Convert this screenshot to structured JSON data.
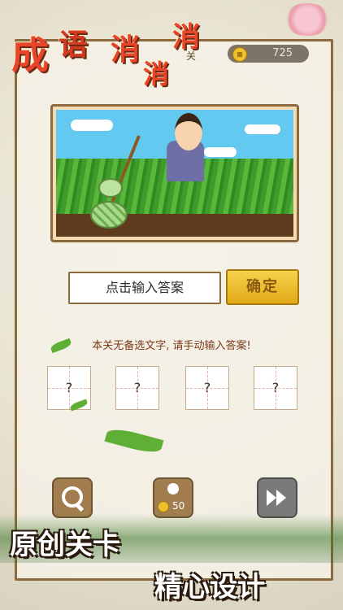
{
  "title": {
    "chars": [
      "成",
      "语",
      "消",
      "消",
      "消"
    ]
  },
  "level_mark": "关",
  "coins": "725",
  "answer_input": {
    "placeholder": "点击输入答案"
  },
  "confirm_label": "确定",
  "tip": "本关无备选文字, 请手动输入答案!",
  "answer_slots": [
    "?",
    "?",
    "?",
    "?"
  ],
  "tools": {
    "search_icon": "search-icon",
    "hint_cost": "50",
    "skip_icon": "fast-forward-icon"
  },
  "promo": {
    "line1": "原创关卡",
    "line2": "精心设计"
  }
}
